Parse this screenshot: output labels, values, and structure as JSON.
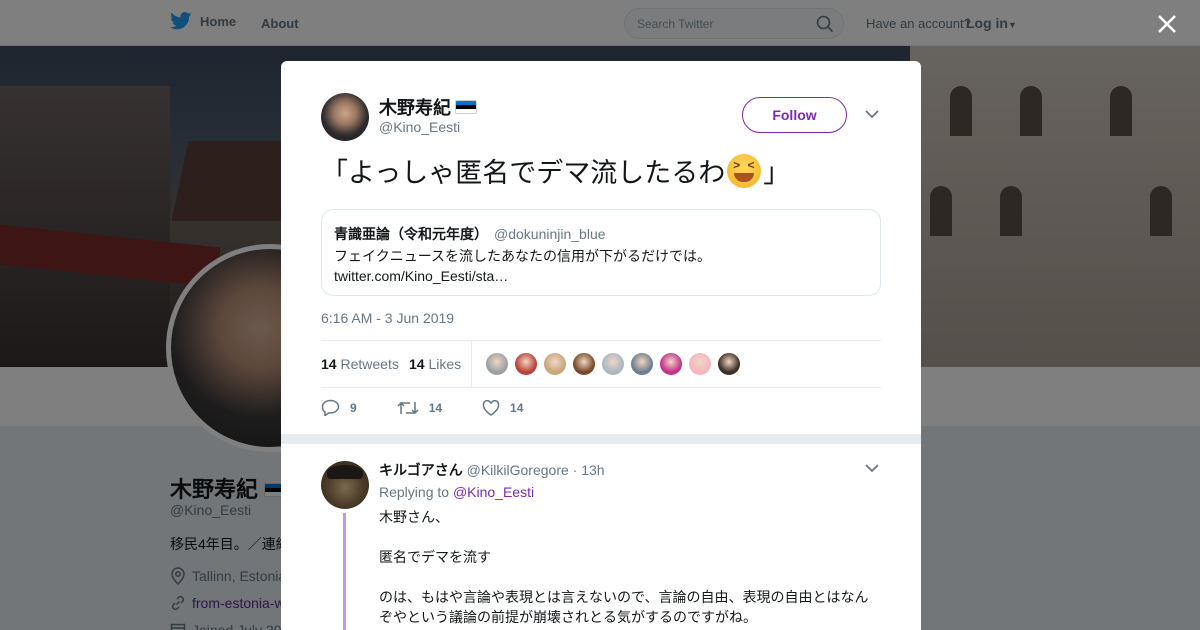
{
  "nav": {
    "home_label": "Home",
    "about_label": "About",
    "search_placeholder": "Search Twitter",
    "have_account": "Have an account?",
    "login_label": "Log in"
  },
  "profile": {
    "name": "木野寿紀",
    "handle": "@Kino_Eesti",
    "bio": "移民4年目。／連絡",
    "location": "Tallinn, Estonia",
    "link": "from-estonia-w",
    "joined": "Joined July 20"
  },
  "tweet": {
    "author_name": "木野寿紀",
    "author_handle": "@Kino_Eesti",
    "follow_label": "Follow",
    "text_before": "「よっしゃ匿名でデマ流したるわ",
    "text_after": "」",
    "quote": {
      "name": "青識亜論（令和元年度）",
      "handle": "@dokuninjin_blue",
      "line1": "フェイクニュースを流したあなたの信用が下がるだけでは。",
      "line2": "twitter.com/Kino_Eesti/sta…"
    },
    "timestamp": "6:16 AM - 3 Jun 2019",
    "retweets_count": "14",
    "retweets_label": "Retweets",
    "likes_count": "14",
    "likes_label": "Likes",
    "liker_faces": [
      "#9aa0a6",
      "#b9433a",
      "#c9a77c",
      "#7a4a2c",
      "#aab8c2",
      "#6d7f8e",
      "#c2338a",
      "#f4b6c2",
      "#3d2f27"
    ],
    "reply_count": "9",
    "retweet_count": "14",
    "like_count": "14"
  },
  "reply": {
    "name": "キルゴアさん",
    "handle": "@KilkilGoregore",
    "time": "· 13h",
    "replying_prefix": "Replying to",
    "replying_to": "@Kino_Eesti",
    "p1": "木野さん、",
    "p2": "匿名でデマを流す",
    "p3": "のは、もはや言論や表現とは言えないので、言論の自由、表現の自由とはなんぞやという議論の前提が崩壊されとる気がするのですがね。"
  },
  "colors": {
    "accent": "#7b2ab0",
    "twitter_blue": "#1da1f2",
    "thread_line": "#c39ae0"
  }
}
